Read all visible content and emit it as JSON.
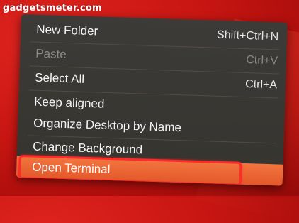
{
  "watermark": "gadgetsmeter.com",
  "menu": {
    "items": [
      {
        "label": "New Folder",
        "shortcut": "Shift+Ctrl+N",
        "enabled": true
      },
      {
        "label": "Paste",
        "shortcut": "Ctrl+V",
        "enabled": false
      },
      {
        "label": "Select All",
        "shortcut": "Ctrl+A",
        "enabled": true
      },
      {
        "label": "Keep aligned",
        "shortcut": "",
        "enabled": true
      },
      {
        "label": "Organize Desktop by Name",
        "shortcut": "",
        "enabled": true
      },
      {
        "label": "Change Background",
        "shortcut": "",
        "enabled": true
      },
      {
        "label": "Open Terminal",
        "shortcut": "",
        "enabled": true,
        "highlighted": true
      }
    ]
  },
  "colors": {
    "highlight": "#e4582a",
    "ring": "#ff2a2a",
    "menu_bg": "#3c3b37"
  }
}
